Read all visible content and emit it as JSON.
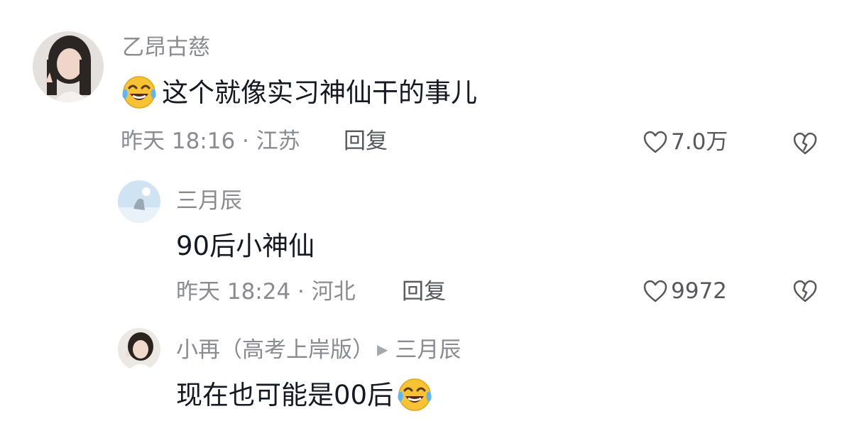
{
  "comments": [
    {
      "username": "乙昂古慈",
      "text": "这个就像实习神仙干的事儿",
      "emoji_before": "laughing-tears-emoji",
      "meta": "昨天 18:16 · 江苏",
      "reply_label": "回复",
      "likes": "7.0万"
    },
    {
      "username": "三月辰",
      "text": "90后小神仙",
      "meta": "昨天 18:24 · 河北",
      "reply_label": "回复",
      "likes": "9972"
    },
    {
      "username": "小再（高考上岸版）",
      "reply_to": "三月辰",
      "reply_arrow": "▶",
      "text": "现在也可能是00后",
      "emoji_after": "laughing-tears-emoji"
    }
  ],
  "icons": {
    "like": "heart-outline-icon",
    "dislike": "broken-heart-icon"
  }
}
